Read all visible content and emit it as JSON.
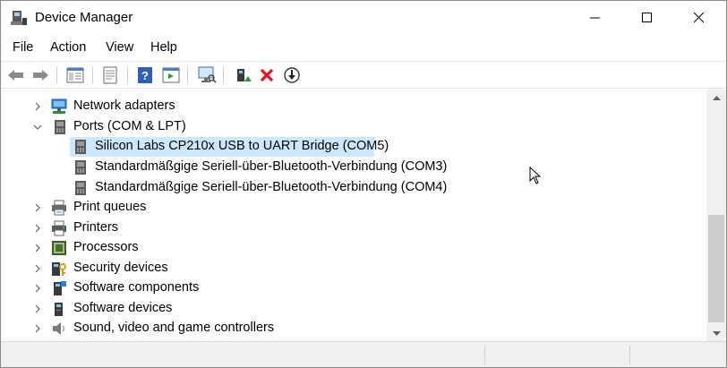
{
  "window": {
    "title": "Device Manager"
  },
  "title_controls": {
    "minimize": "—",
    "maximize": "☐",
    "close": "✕"
  },
  "menu": [
    {
      "label": "File"
    },
    {
      "label": "Action"
    },
    {
      "label": "View"
    },
    {
      "label": "Help"
    }
  ],
  "toolbar": [
    {
      "name": "back-icon"
    },
    {
      "name": "forward-icon"
    },
    {
      "name": "properties-pane-icon"
    },
    {
      "name": "properties-icon"
    },
    {
      "name": "help-icon"
    },
    {
      "name": "action-pane-icon"
    },
    {
      "name": "scan-hardware-icon"
    },
    {
      "name": "update-driver-icon"
    },
    {
      "name": "uninstall-device-icon"
    },
    {
      "name": "disable-device-icon"
    }
  ],
  "tree": {
    "items": [
      {
        "label": "Network adapters",
        "expanded": false,
        "icon": "network-adapter-icon",
        "level": 0
      },
      {
        "label": "Ports (COM & LPT)",
        "expanded": true,
        "icon": "port-icon",
        "level": 0
      },
      {
        "label": "Silicon Labs CP210x USB to UART Bridge (COM5)",
        "icon": "port-device-icon",
        "level": 1,
        "selected": true
      },
      {
        "label": "Standardmäßgige Seriell-über-Bluetooth-Verbindung (COM3)",
        "icon": "port-device-icon",
        "level": 1
      },
      {
        "label": "Standardmäßgige Seriell-über-Bluetooth-Verbindung (COM4)",
        "icon": "port-device-icon",
        "level": 1
      },
      {
        "label": "Print queues",
        "expanded": false,
        "icon": "print-queue-icon",
        "level": 0
      },
      {
        "label": "Printers",
        "expanded": false,
        "icon": "printer-icon",
        "level": 0
      },
      {
        "label": "Processors",
        "expanded": false,
        "icon": "processor-icon",
        "level": 0
      },
      {
        "label": "Security devices",
        "expanded": false,
        "icon": "security-device-icon",
        "level": 0
      },
      {
        "label": "Software components",
        "expanded": false,
        "icon": "software-component-icon",
        "level": 0
      },
      {
        "label": "Software devices",
        "expanded": false,
        "icon": "software-device-icon",
        "level": 0
      },
      {
        "label": "Sound, video and game controllers",
        "expanded": false,
        "icon": "sound-icon",
        "level": 0
      }
    ]
  },
  "colors": {
    "selection": "#cce8ff",
    "uninstall_red": "#e81123",
    "update_green": "#1a9e3a"
  }
}
